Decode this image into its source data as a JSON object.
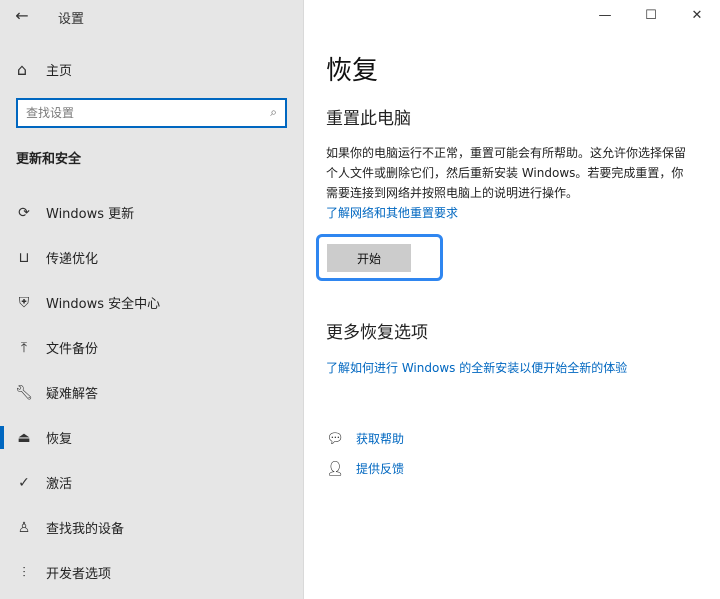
{
  "window": {
    "title": "设置",
    "controls": {
      "minimize": "—",
      "maximize": "☐",
      "close": "✕"
    }
  },
  "sidebar": {
    "home_label": "主页",
    "search_placeholder": "查找设置",
    "section_title": "更新和安全",
    "items": [
      {
        "label": "Windows 更新",
        "icon": "sync-icon"
      },
      {
        "label": "传递优化",
        "icon": "delivery-optimization-icon"
      },
      {
        "label": "Windows 安全中心",
        "icon": "shield-icon"
      },
      {
        "label": "文件备份",
        "icon": "backup-icon"
      },
      {
        "label": "疑难解答",
        "icon": "wrench-icon"
      },
      {
        "label": "恢复",
        "icon": "recovery-icon"
      },
      {
        "label": "激活",
        "icon": "activation-icon"
      },
      {
        "label": "查找我的设备",
        "icon": "find-device-icon"
      },
      {
        "label": "开发者选项",
        "icon": "developer-icon"
      }
    ],
    "selected_index": 5
  },
  "main": {
    "page_title": "恢复",
    "reset_section": {
      "heading": "重置此电脑",
      "description": "如果你的电脑运行不正常，重置可能会有所帮助。这允许你选择保留个人文件或删除它们，然后重新安装 Windows。若要完成重置，你需要连接到网络并按照电脑上的说明进行操作。",
      "link": "了解网络和其他重置要求",
      "button": "开始"
    },
    "more_section": {
      "heading": "更多恢复选项",
      "link": "了解如何进行 Windows 的全新安装以便开始全新的体验"
    },
    "help": {
      "get_help": "获取帮助",
      "feedback": "提供反馈"
    }
  },
  "colors": {
    "accent": "#0067c0",
    "highlight_border": "#2f86f0",
    "sidebar_bg": "#e6e6e6",
    "button_bg": "#cccccc"
  }
}
